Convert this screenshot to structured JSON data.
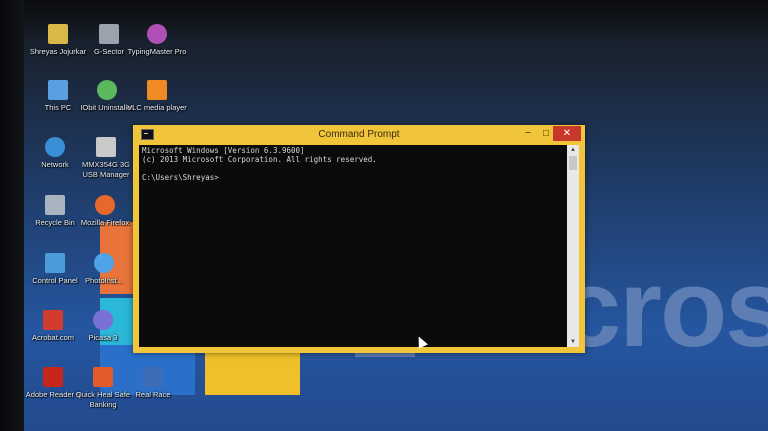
{
  "desktop": {
    "icons": [
      {
        "label": "Shreyas Jojurkar",
        "icon": "folder-icon",
        "color": "#d9b84a"
      },
      {
        "label": "G-Sector",
        "icon": "g-sector-icon",
        "color": "#9aa3ad"
      },
      {
        "label": "TypingMaster Pro",
        "icon": "typingmaster-icon",
        "color": "#b04fb5"
      },
      {
        "label": "This PC",
        "icon": "computer-icon",
        "color": "#5aa0e0"
      },
      {
        "label": "IObit Uninstaller",
        "icon": "iobit-icon",
        "color": "#5cb85c"
      },
      {
        "label": "VLC media player",
        "icon": "vlc-icon",
        "color": "#f08a24"
      },
      {
        "label": "Network",
        "icon": "network-icon",
        "color": "#3a8fd6"
      },
      {
        "label": "MMX354G 3G USB Manager",
        "icon": "usb-modem-icon",
        "color": "#c9c9c9"
      },
      {
        "label": "Recycle Bin",
        "icon": "recycle-bin-icon",
        "color": "#a8b4c0"
      },
      {
        "label": "Mozilla Firefox",
        "icon": "firefox-icon",
        "color": "#e6682a"
      },
      {
        "label": "Control Panel",
        "icon": "control-panel-icon",
        "color": "#4a9bd8"
      },
      {
        "label": "PhotoInst...",
        "icon": "photo-icon",
        "color": "#4fa3e8"
      },
      {
        "label": "Acrobat.com",
        "icon": "acrobat-com-icon",
        "color": "#d23c2e"
      },
      {
        "label": "Picasa 3",
        "icon": "picasa-icon",
        "color": "#7a6fd4"
      },
      {
        "label": "Adobe Reader 9",
        "icon": "adobe-reader-icon",
        "color": "#c8261b"
      },
      {
        "label": "Quick Heal Safe Banking",
        "icon": "quick-heal-icon",
        "color": "#e45a2a"
      },
      {
        "label": "Real Race",
        "icon": "real-race-icon",
        "color": "#3f6db5"
      }
    ],
    "wallpaper_text": "cros"
  },
  "cmd_window": {
    "title": "Command Prompt",
    "minimize": "−",
    "maximize": "□",
    "close": "✕",
    "lines": [
      "Microsoft Windows [Version 6.3.9600]",
      "(c) 2013 Microsoft Corporation. All rights reserved.",
      "C:\\Users\\Shreyas>"
    ],
    "scroll_up": "▲",
    "scroll_down": "▼"
  }
}
